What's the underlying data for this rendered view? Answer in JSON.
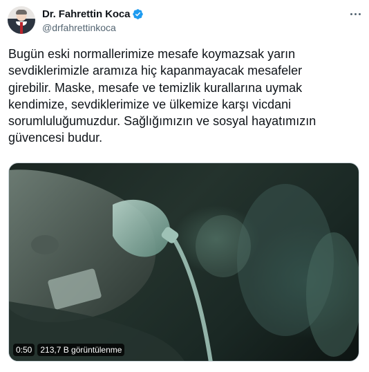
{
  "author": {
    "display_name": "Dr. Fahrettin Koca",
    "handle": "@drfahrettinkoca",
    "verified": true,
    "avatar_icon": "profile-photo"
  },
  "tweet": {
    "text": "Bugün eski normallerimize mesafe koymazsak yarın\nsevdiklerimizle aramıza hiç kapanmayacak mesafeler\ngirebilir. Maske, mesafe ve temizlik kurallarına uymak\nkendimize, sevdiklerimize ve ülkemize karşı vicdani\nsorumluluğumuzdur. Sağlığımızın ve sosyal hayatımızın\ngüvencesi budur."
  },
  "media": {
    "type": "video",
    "duration": "0:50",
    "views": "213,7 B görüntülenme"
  },
  "icons": {
    "more": "more-options-icon",
    "verified": "verified-badge-icon"
  },
  "colors": {
    "verified_blue": "#1d9bf0",
    "handle_gray": "#536471",
    "text": "#0f1419"
  }
}
